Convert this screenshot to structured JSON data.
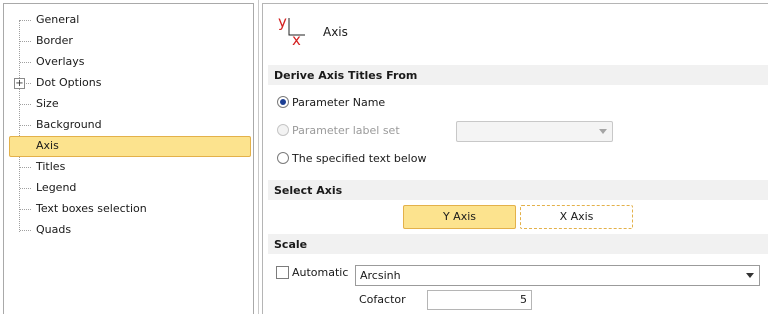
{
  "tree": {
    "items": [
      {
        "label": "General"
      },
      {
        "label": "Border"
      },
      {
        "label": "Overlays"
      },
      {
        "label": "Dot Options",
        "expandable": true
      },
      {
        "label": "Size"
      },
      {
        "label": "Background"
      },
      {
        "label": "Axis",
        "selected": true
      },
      {
        "label": "Titles"
      },
      {
        "label": "Legend"
      },
      {
        "label": "Text boxes selection"
      },
      {
        "label": "Quads"
      }
    ],
    "expander_glyph": "+"
  },
  "header": {
    "icon": "axis-xy-icon",
    "icon_y": "y",
    "icon_x": "x",
    "title": "Axis"
  },
  "derive": {
    "section_title": "Derive Axis Titles From",
    "options": [
      {
        "label": "Parameter Name",
        "checked": true
      },
      {
        "label": "Parameter label set",
        "disabled": true
      },
      {
        "label": "The specified text below"
      }
    ],
    "label_set_value": ""
  },
  "select_axis": {
    "section_title": "Select Axis",
    "buttons": [
      {
        "label": "Y Axis",
        "active": true
      },
      {
        "label": "X Axis"
      }
    ]
  },
  "scale": {
    "section_title": "Scale",
    "automatic_label": "Automatic",
    "automatic_checked": false,
    "scale_type": "Arcsinh",
    "cofactor_label": "Cofactor",
    "cofactor_value": "5"
  },
  "colors": {
    "selection_fill": "#fce38e",
    "selection_border": "#e3b14a",
    "icon_red": "#d42020",
    "section_bg": "#f1f1f1"
  }
}
